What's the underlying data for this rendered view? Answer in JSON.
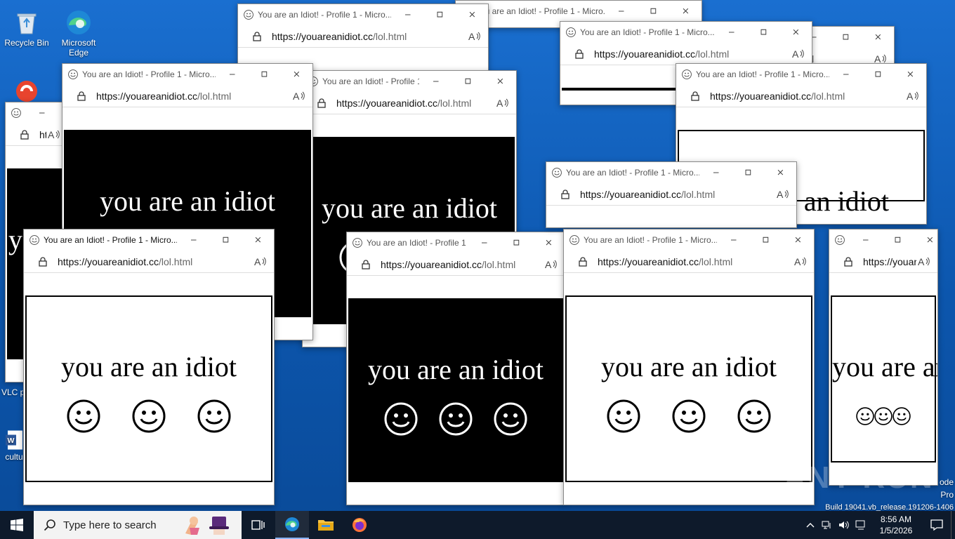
{
  "desktop": {
    "icons": [
      {
        "label": "Recycle Bin"
      },
      {
        "label": "Microsoft Edge"
      },
      {
        "label": "VLC pl"
      },
      {
        "label": "cultu"
      }
    ],
    "build_lines": [
      "ode",
      "Pro",
      "Build 19041.vb_release.191206-1406"
    ],
    "watermark": "ANY RUN"
  },
  "popup": {
    "title": "You are an Idiot! - Profile 1 - Micro...",
    "url_domain": "https://youareanidiot.cc",
    "url_path": "/lol.html",
    "message": "you are an idiot"
  },
  "taskbar": {
    "search_placeholder": "Type here to search",
    "time": "8:56 AM",
    "date": "1/5/2026"
  },
  "colors": {
    "desktop": "#0c56ad",
    "taskbar": "#0e1a2b",
    "popup_dark": "#000000",
    "popup_light": "#ffffff"
  },
  "icons": [
    "start-icon",
    "search-icon",
    "task-view-icon",
    "edge-icon",
    "file-explorer-icon",
    "firefox-icon",
    "smiley-icon",
    "lock-icon",
    "read-aloud-icon",
    "minimize-icon",
    "maximize-icon",
    "close-icon",
    "chevron-up-icon",
    "network-icon",
    "volume-icon",
    "ime-icon",
    "notifications-icon"
  ]
}
